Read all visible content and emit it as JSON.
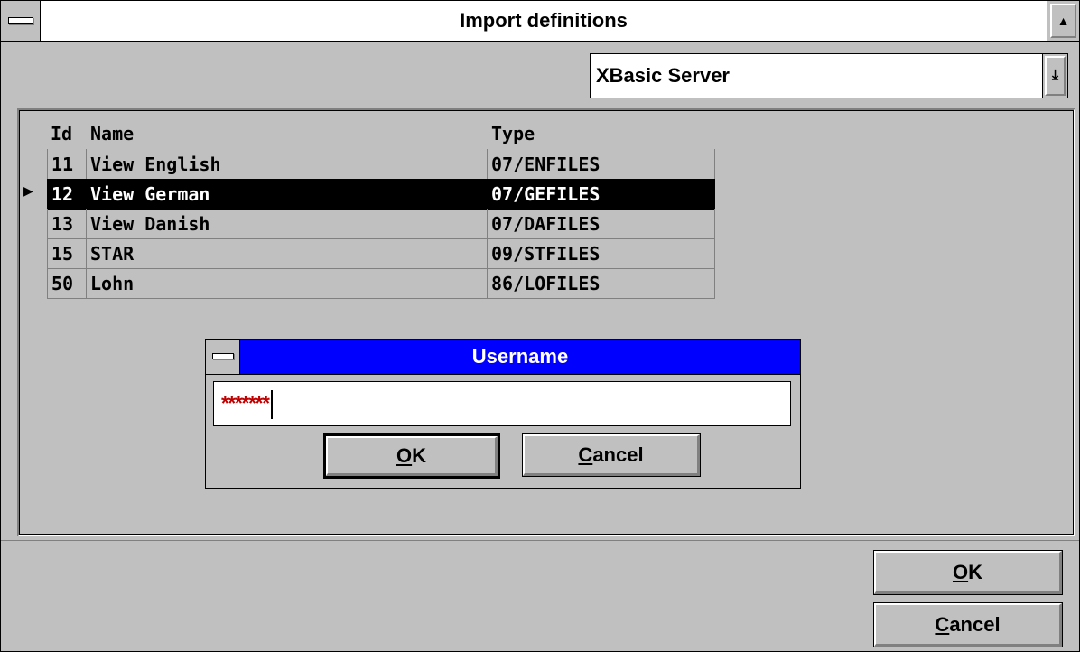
{
  "window": {
    "title": "Import definitions",
    "sys_menu_icon": "window-menu-icon",
    "maximize_icon": "scroll-up-arrow-icon"
  },
  "server_select": {
    "value": "XBasic Server",
    "icon": "dropdown-arrow-icon"
  },
  "table": {
    "headers": {
      "id": "Id",
      "name": "Name",
      "type": "Type"
    },
    "rows": [
      {
        "id": "11",
        "name": "View English",
        "type": "07/ENFILES"
      },
      {
        "id": "12",
        "name": "View German",
        "type": "07/GEFILES"
      },
      {
        "id": "13",
        "name": "View Danish",
        "type": "07/DAFILES"
      },
      {
        "id": "15",
        "name": "STAR",
        "type": "09/STFILES"
      },
      {
        "id": "50",
        "name": "Lohn",
        "type": "86/LOFILES"
      }
    ],
    "selected_index": 1
  },
  "dialog": {
    "title": "Username",
    "input_value": "*******",
    "ok_mnemonic": "O",
    "ok_rest": "K",
    "cancel_mnemonic": "C",
    "cancel_rest": "ancel"
  },
  "footer": {
    "ok_mnemonic": "O",
    "ok_rest": "K",
    "cancel_mnemonic": "C",
    "cancel_rest": "ancel"
  },
  "colors": {
    "window_bg": "#c0c0c0",
    "dialog_title_bg": "#0000ff",
    "password_text": "#c00000",
    "selection_bg": "#000000"
  }
}
